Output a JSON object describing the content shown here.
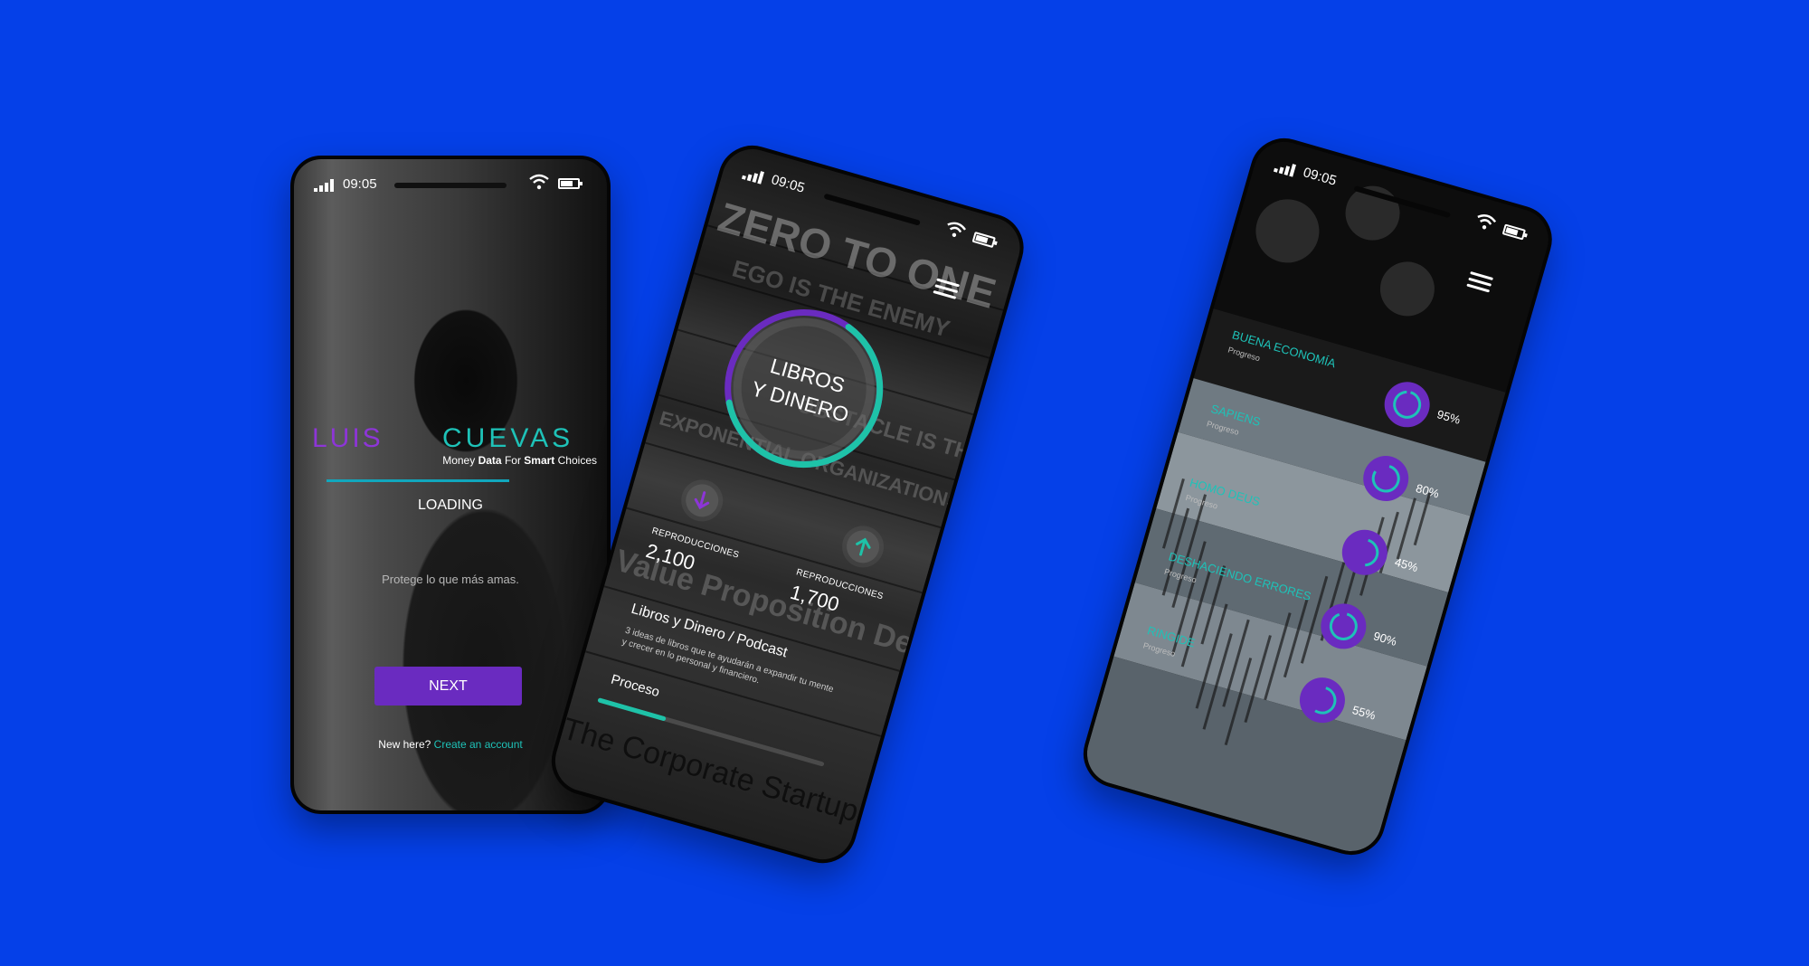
{
  "colors": {
    "background": "#0540e8",
    "purple": "#6a2bc0",
    "teal": "#1ec2b8"
  },
  "phone1": {
    "status": {
      "time": "09:05",
      "icons": [
        "signal-icon",
        "wifi-icon",
        "battery-icon"
      ]
    },
    "logo": {
      "first": "LUIS",
      "last": "CUEVAS"
    },
    "tagline": {
      "w1": "Money",
      "w2": "Data",
      "w3": "For",
      "w4": "Smart",
      "w5": "Choices"
    },
    "loading": "LOADING",
    "loading_progress": 0.6,
    "protect": "Protege lo que más amas.",
    "next_label": "NEXT",
    "new_here": "New here?",
    "create_account": "Create an account"
  },
  "phone2": {
    "status": {
      "time": "09:05"
    },
    "title_line1": "LIBROS",
    "title_line2": "Y DINERO",
    "ring_progress": 0.62,
    "left": {
      "label": "REPRODUCCIONES",
      "value": "2,100"
    },
    "right": {
      "label": "REPRODUCCIONES",
      "value": "1,700"
    },
    "podcast_title": "Libros y Dinero / Podcast",
    "podcast_desc_line1": "3 ideas de libros que te ayudarán a expandir tu mente",
    "podcast_desc_line2": "y crecer en lo personal y financiero.",
    "process_label": "Proceso",
    "process_progress": 0.3,
    "background_text": [
      "ZERO TO ONE",
      "EGO IS THE ENEMY",
      "OBSTACLE IS THE WAY",
      "EXPONENTIAL ORGANIZATIONS",
      "Value Proposition Design",
      "The Corporate Startup"
    ]
  },
  "phone3": {
    "status": {
      "time": "09:05"
    },
    "items": [
      {
        "name": "BUENA ECONOMÍA",
        "sub": "Progreso",
        "percent": "95%",
        "progress": 0.95
      },
      {
        "name": "SAPIENS",
        "sub": "Progreso",
        "percent": "80%",
        "progress": 0.8
      },
      {
        "name": "HOMO DEUS",
        "sub": "Progreso",
        "percent": "45%",
        "progress": 0.45
      },
      {
        "name": "DESHACIENDO ERRORES",
        "sub": "Progreso",
        "percent": "90%",
        "progress": 0.9
      },
      {
        "name": "RINGIDE",
        "sub": "Progreso",
        "percent": "55%",
        "progress": 0.55
      }
    ]
  }
}
